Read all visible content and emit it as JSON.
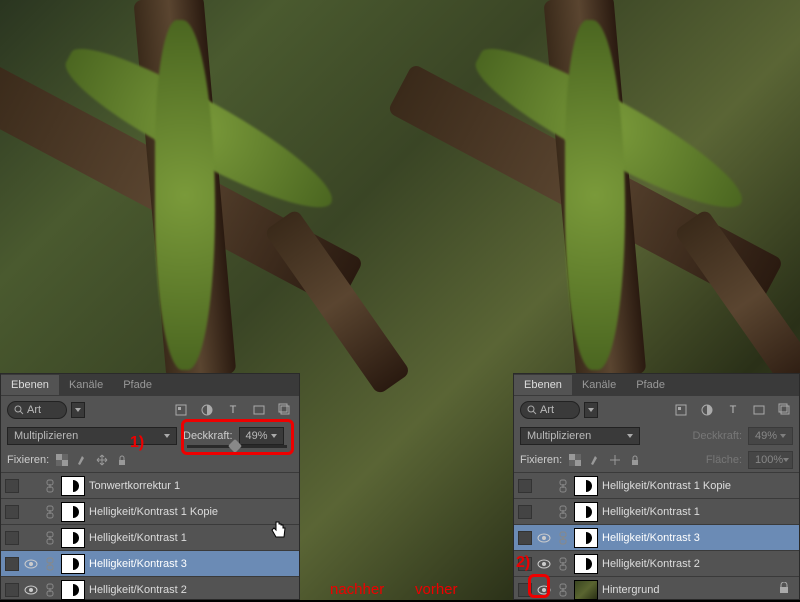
{
  "captions": {
    "left": "nachher",
    "right": "vorher"
  },
  "annotations": {
    "left": "1)",
    "right": "2)"
  },
  "tabs": [
    "Ebenen",
    "Kanäle",
    "Pfade"
  ],
  "search": {
    "label": "Art"
  },
  "leftPanel": {
    "blendMode": "Multiplizieren",
    "opacityLabel": "Deckkraft:",
    "opacityValue": "49%",
    "lockLabel": "Fixieren:",
    "layers": [
      {
        "name": "Tonwertkorrektur 1",
        "vis": false,
        "sel": false
      },
      {
        "name": "Helligkeit/Kontrast 1 Kopie",
        "vis": false,
        "sel": false
      },
      {
        "name": "Helligkeit/Kontrast 1",
        "vis": false,
        "sel": false
      },
      {
        "name": "Helligkeit/Kontrast 3",
        "vis": true,
        "sel": true
      },
      {
        "name": "Helligkeit/Kontrast 2",
        "vis": true,
        "sel": false
      }
    ]
  },
  "rightPanel": {
    "blendMode": "Multiplizieren",
    "opacityLabel": "Deckkraft:",
    "opacityValue": "49%",
    "fillLabel": "Fläche:",
    "fillValue": "100%",
    "lockLabel": "Fixieren:",
    "layers": [
      {
        "name": "Helligkeit/Kontrast 1 Kopie",
        "vis": false,
        "sel": false,
        "type": "adj"
      },
      {
        "name": "Helligkeit/Kontrast 1",
        "vis": false,
        "sel": false,
        "type": "adj"
      },
      {
        "name": "Helligkeit/Kontrast 3",
        "vis": true,
        "sel": true,
        "type": "adj"
      },
      {
        "name": "Helligkeit/Kontrast 2",
        "vis": true,
        "sel": false,
        "type": "adj"
      },
      {
        "name": "Hintergrund",
        "vis": true,
        "sel": false,
        "type": "img",
        "locked": true
      }
    ]
  }
}
